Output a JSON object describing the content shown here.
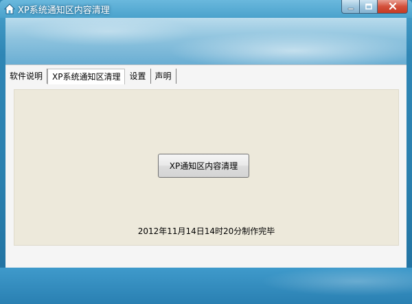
{
  "window": {
    "title": "XP系统通知区内容清理",
    "accent_color": "#2f86b5",
    "icons": {
      "app": "house-icon",
      "minimize": "minimize-icon",
      "maximize": "maximize-icon",
      "close": "close-icon"
    }
  },
  "tabs": [
    {
      "label": "软件说明",
      "active": false
    },
    {
      "label": "XP系统通知区清理",
      "active": true
    },
    {
      "label": "设置",
      "active": false
    },
    {
      "label": "声明",
      "active": false
    }
  ],
  "panel": {
    "background_color": "#ede9db",
    "button_label": "XP通知区内容清理",
    "made_text": "2012年11月14日14时20分制作完毕"
  }
}
